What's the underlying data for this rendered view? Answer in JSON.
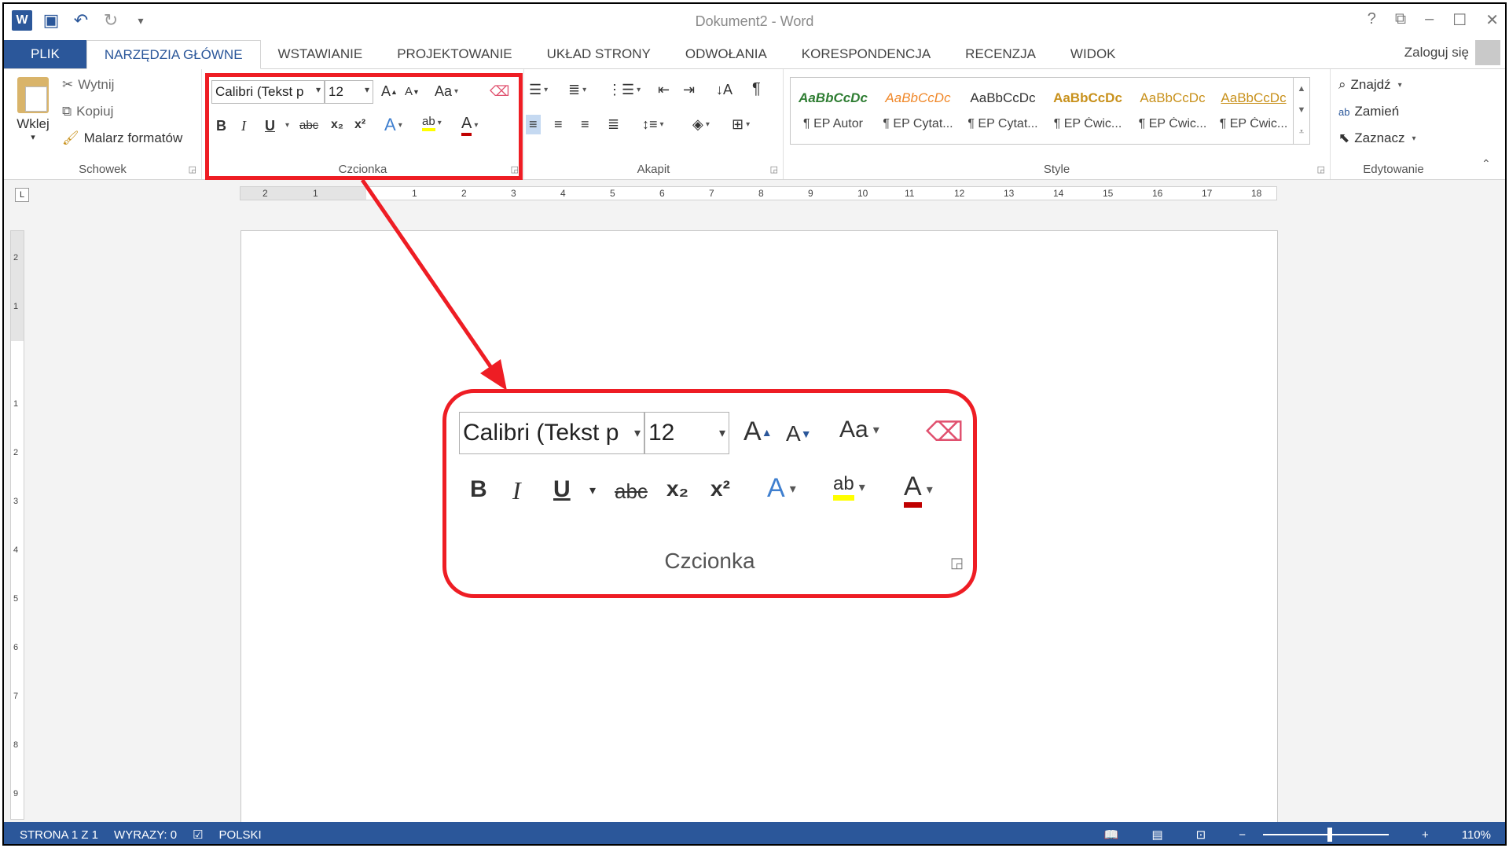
{
  "app": {
    "title": "Dokument2 - Word"
  },
  "titlebar": {
    "help": "?",
    "minimize": "–",
    "maximize": "☐",
    "close": "✕"
  },
  "tabs": [
    {
      "label": "PLIK"
    },
    {
      "label": "NARZĘDZIA GŁÓWNE"
    },
    {
      "label": "WSTAWIANIE"
    },
    {
      "label": "PROJEKTOWANIE"
    },
    {
      "label": "UKŁAD STRONY"
    },
    {
      "label": "ODWOŁANIA"
    },
    {
      "label": "KORESPONDENCJA"
    },
    {
      "label": "RECENZJA"
    },
    {
      "label": "WIDOK"
    }
  ],
  "account": {
    "login": "Zaloguj się"
  },
  "clipboard": {
    "paste": "Wklej",
    "cut": "Wytnij",
    "copy": "Kopiuj",
    "painter": "Malarz formatów",
    "group": "Schowek"
  },
  "font": {
    "name": "Calibri (Tekst p",
    "size": "12",
    "case": "Aa",
    "bold": "B",
    "italic": "I",
    "underline": "U",
    "strike": "abc",
    "sub": "x₂",
    "sup": "x²",
    "group": "Czcionka"
  },
  "paragraph": {
    "group": "Akapit",
    "pilcrow": "¶"
  },
  "styles": {
    "group": "Style",
    "items": [
      {
        "sample": "AaBbCcDc",
        "name": "¶ EP Autor",
        "color": "#2e7d32"
      },
      {
        "sample": "AaBbCcDc",
        "name": "¶ EP Cytat...",
        "color": "#f0882a"
      },
      {
        "sample": "AaBbCcDc",
        "name": "¶ EP Cytat...",
        "color": "#333333"
      },
      {
        "sample": "AaBbCcDc",
        "name": "¶ EP Ćwic...",
        "color": "#c8911c"
      },
      {
        "sample": "AaBbCcDc",
        "name": "¶ EP Ćwic...",
        "color": "#c8911c"
      },
      {
        "sample": "AaBbCcDc",
        "name": "¶ EP Ćwic...",
        "color": "#c8911c"
      }
    ]
  },
  "editing": {
    "find": "Znajdź",
    "replace": "Zamień",
    "select": "Zaznacz",
    "group": "Edytowanie"
  },
  "ruler": {
    "numbers": [
      "2",
      "1",
      "",
      "1",
      "2",
      "3",
      "4",
      "5",
      "6",
      "7",
      "8",
      "9",
      "10",
      "11",
      "12",
      "13",
      "14",
      "15",
      "16",
      "17",
      "18"
    ],
    "vnumbers": [
      "2",
      "1",
      "",
      "1",
      "2",
      "3",
      "4",
      "5",
      "6",
      "7",
      "8",
      "9"
    ]
  },
  "status": {
    "page": "STRONA 1 Z 1",
    "words": "WYRAZY: 0",
    "language": "POLSKI",
    "zoom": "110%"
  },
  "colors": {
    "accent": "#2b579a",
    "highlight": "#ee1d24",
    "fontcolor": "#c00000",
    "marker": "#ffff00"
  }
}
